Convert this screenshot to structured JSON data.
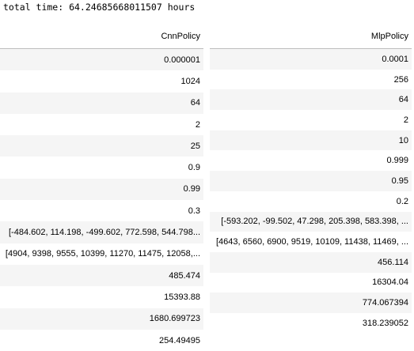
{
  "output": {
    "total_time": "total time: 64.24685668011507 hours"
  },
  "tables": {
    "cnn": {
      "header": "CnnPolicy",
      "values": [
        "0.000001",
        "1024",
        "64",
        "2",
        "25",
        "0.9",
        "0.99",
        "0.3",
        "[-484.602, 114.198, -499.602, 772.598, 544.798...",
        "[4904, 9398, 9555, 10399, 11270, 11475, 12058,...",
        "485.474",
        "15393.88",
        "1680.699723",
        "254.49495"
      ]
    },
    "mlp": {
      "header": "MlpPolicy",
      "values": [
        "0.0001",
        "256",
        "64",
        "2",
        "10",
        "0.999",
        "0.95",
        "0.2",
        "[-593.202, -99.502, 47.298, 205.398, 583.398, ...",
        "[4643, 6560, 6900, 9519, 10109, 11438, 11469, ...",
        "456.114",
        "16304.04",
        "774.067394",
        "318.239052"
      ]
    }
  }
}
